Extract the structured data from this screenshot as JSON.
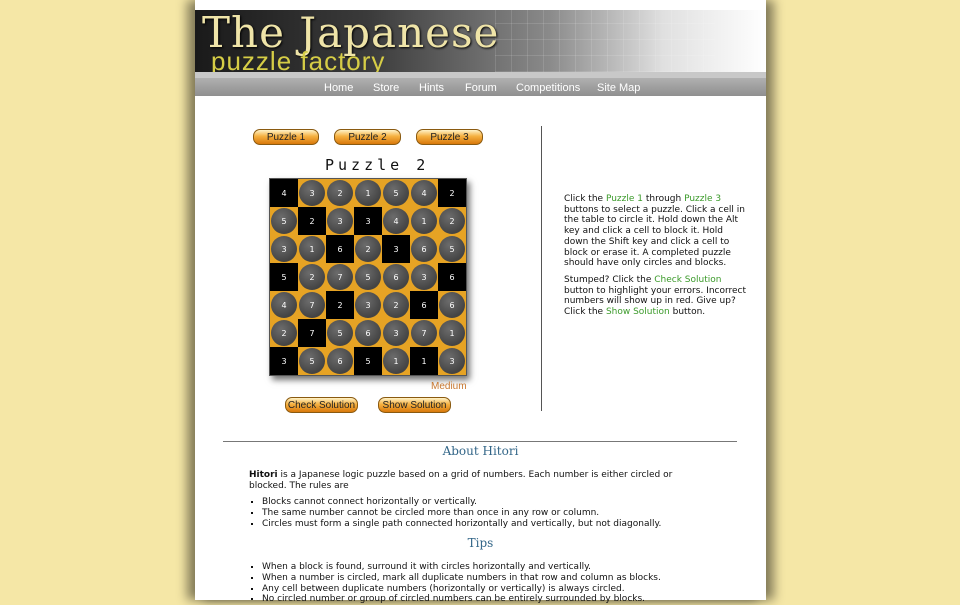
{
  "header": {
    "title_line1": "The Japanese",
    "title_line2": "puzzle factory"
  },
  "nav": {
    "items": [
      "Home",
      "Store",
      "Hints",
      "Forum",
      "Competitions",
      "Site Map"
    ]
  },
  "puzzle_buttons": [
    "Puzzle 1",
    "Puzzle 2",
    "Puzzle 3"
  ],
  "puzzle": {
    "title": "Puzzle 2",
    "difficulty": "Medium",
    "grid": [
      [
        [
          4,
          "b"
        ],
        [
          3,
          "c"
        ],
        [
          2,
          "c"
        ],
        [
          1,
          "c"
        ],
        [
          5,
          "c"
        ],
        [
          4,
          "c"
        ],
        [
          2,
          "b"
        ]
      ],
      [
        [
          5,
          "c"
        ],
        [
          2,
          "b"
        ],
        [
          3,
          "c"
        ],
        [
          3,
          "b"
        ],
        [
          4,
          "c"
        ],
        [
          1,
          "c"
        ],
        [
          2,
          "c"
        ]
      ],
      [
        [
          3,
          "c"
        ],
        [
          1,
          "c"
        ],
        [
          6,
          "b"
        ],
        [
          2,
          "c"
        ],
        [
          3,
          "b"
        ],
        [
          6,
          "c"
        ],
        [
          5,
          "c"
        ]
      ],
      [
        [
          5,
          "b"
        ],
        [
          2,
          "c"
        ],
        [
          7,
          "c"
        ],
        [
          5,
          "c"
        ],
        [
          6,
          "c"
        ],
        [
          3,
          "c"
        ],
        [
          6,
          "b"
        ]
      ],
      [
        [
          4,
          "c"
        ],
        [
          7,
          "c"
        ],
        [
          2,
          "b"
        ],
        [
          3,
          "c"
        ],
        [
          2,
          "c"
        ],
        [
          6,
          "b"
        ],
        [
          6,
          "c"
        ]
      ],
      [
        [
          2,
          "c"
        ],
        [
          7,
          "b"
        ],
        [
          5,
          "c"
        ],
        [
          6,
          "c"
        ],
        [
          3,
          "c"
        ],
        [
          7,
          "c"
        ],
        [
          1,
          "c"
        ]
      ],
      [
        [
          3,
          "b"
        ],
        [
          5,
          "c"
        ],
        [
          6,
          "c"
        ],
        [
          5,
          "b"
        ],
        [
          1,
          "c"
        ],
        [
          1,
          "b"
        ],
        [
          3,
          "c"
        ]
      ]
    ],
    "check_label": "Check Solution",
    "show_label": "Show Solution"
  },
  "instructions": {
    "p1_a": "Click the ",
    "p1_link1": "Puzzle 1",
    "p1_b": " through ",
    "p1_link2": "Puzzle 3",
    "p1_c": " buttons to select a puzzle. Click a cell in the table to circle it. Hold down the Alt key and click a cell to block it. Hold down the Shift key and click a cell to block or erase it. A completed puzzle should have only circles and blocks.",
    "p2_a": "Stumped? Click the ",
    "p2_link1": "Check Solution",
    "p2_b": " button to highlight your errors. Incorrect numbers will show up in red. Give up? Click the ",
    "p2_link2": "Show Solution",
    "p2_c": " button."
  },
  "about": {
    "heading": "About Hitori",
    "intro_bold": "Hitori",
    "intro_rest": " is a Japanese logic puzzle based on a grid of numbers. Each number is either circled or blocked. The rules are",
    "rules": [
      "Blocks cannot connect horizontally or vertically.",
      "The same number cannot be circled more than once in any row or column.",
      "Circles must form a single path connected horizontally and vertically, but not diagonally."
    ]
  },
  "tips": {
    "heading": "Tips",
    "items": [
      "When a block is found, surround it with circles horizontally and vertically.",
      "When a number is circled, mark all duplicate numbers in that row and column as blocks.",
      "Any cell between duplicate numbers (horizontally or vertically) is always circled.",
      "No circled number or group of circled numbers can be entirely surrounded by blocks."
    ]
  }
}
